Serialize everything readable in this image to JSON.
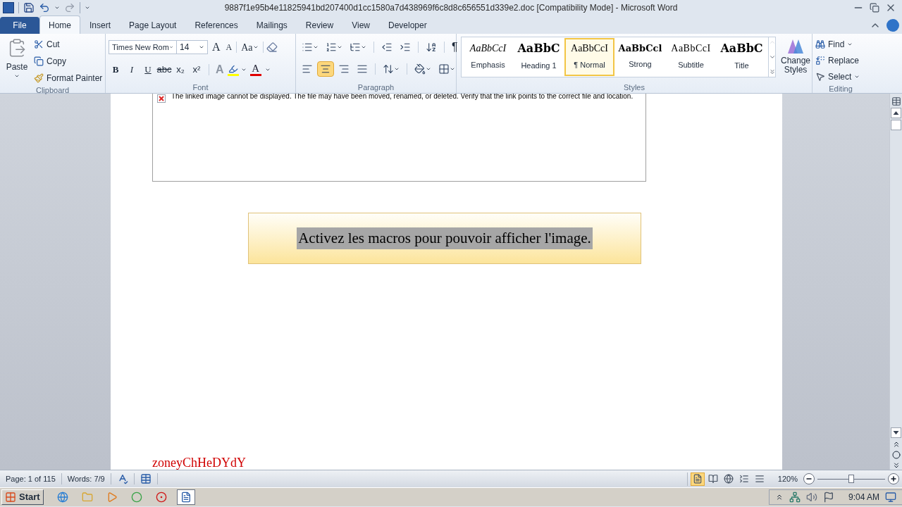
{
  "window": {
    "title": "9887f1e95b4e11825941bd207400d1cc1580a7d438969f6c8d8c656551d339e2.doc [Compatibility Mode]  -  Microsoft Word"
  },
  "tabs": [
    {
      "label": "File",
      "kind": "file",
      "selected": false
    },
    {
      "label": "Home",
      "kind": "tab",
      "selected": true
    },
    {
      "label": "Insert",
      "kind": "tab",
      "selected": false
    },
    {
      "label": "Page Layout",
      "kind": "tab",
      "selected": false
    },
    {
      "label": "References",
      "kind": "tab",
      "selected": false
    },
    {
      "label": "Mailings",
      "kind": "tab",
      "selected": false
    },
    {
      "label": "Review",
      "kind": "tab",
      "selected": false
    },
    {
      "label": "View",
      "kind": "tab",
      "selected": false
    },
    {
      "label": "Developer",
      "kind": "tab",
      "selected": false
    }
  ],
  "clipboard": {
    "label": "Clipboard",
    "paste": "Paste",
    "cut": "Cut",
    "copy": "Copy",
    "format_painter": "Format Painter"
  },
  "font": {
    "label": "Font",
    "family": "Times New Rom",
    "size": "14",
    "grow": "A",
    "shrink": "A",
    "change_case": "Aa",
    "format_buttons": [
      "B",
      "I",
      "U",
      "abc",
      "x₂",
      "x²"
    ],
    "text_effects": "A",
    "font_color": "A"
  },
  "paragraph": {
    "label": "Paragraph",
    "show_marks": "¶",
    "align_buttons": [
      {
        "selected": false
      },
      {
        "selected": true
      },
      {
        "selected": false
      },
      {
        "selected": false
      }
    ]
  },
  "styles": {
    "label": "Styles",
    "items": [
      {
        "preview": "AaBbCcI",
        "name": "Emphasis",
        "kind": "italic",
        "selected": false
      },
      {
        "preview": "AaBbC",
        "name": "Heading 1",
        "kind": "heading",
        "selected": false
      },
      {
        "preview": "AaBbCcI",
        "name": "¶ Normal",
        "kind": "normal",
        "selected": true
      },
      {
        "preview": "AaBbCcl",
        "name": "Strong",
        "kind": "strong",
        "selected": false
      },
      {
        "preview": "AaBbCcI",
        "name": "Subtitle",
        "kind": "spaced",
        "selected": false
      },
      {
        "preview": "AaBbC",
        "name": "Title",
        "kind": "heading",
        "selected": false
      }
    ],
    "change_styles": "Change Styles"
  },
  "editing": {
    "label": "Editing",
    "find": "Find",
    "replace": "Replace",
    "select": "Select"
  },
  "document": {
    "broken_image_message": "The linked image cannot be displayed.  The file may have been moved, renamed, or deleted. Verify that the link points to the correct file and location.",
    "macro_banner": {
      "text": "Activez les macros pour pouvoir afficher l'image.",
      "selected": true
    },
    "footer_text": "zoneyChHeDYdY"
  },
  "status_bar": {
    "page": "Page: 1 of 115",
    "words": "Words: 7/9",
    "views": [
      {
        "selected": true
      },
      {
        "selected": false
      },
      {
        "selected": false
      },
      {
        "selected": false
      },
      {
        "selected": false
      }
    ],
    "zoom": "120%",
    "zoom_slider": {
      "level": 0.5
    }
  },
  "taskbar": {
    "start": "Start",
    "apps": [
      {
        "kind": "ie",
        "selected": false
      },
      {
        "kind": "folder",
        "selected": false
      },
      {
        "kind": "media",
        "selected": false
      },
      {
        "kind": "chrome",
        "selected": false
      },
      {
        "kind": "opera",
        "selected": false
      },
      {
        "kind": "word",
        "selected": true
      }
    ],
    "clock": "9:04 AM"
  }
}
